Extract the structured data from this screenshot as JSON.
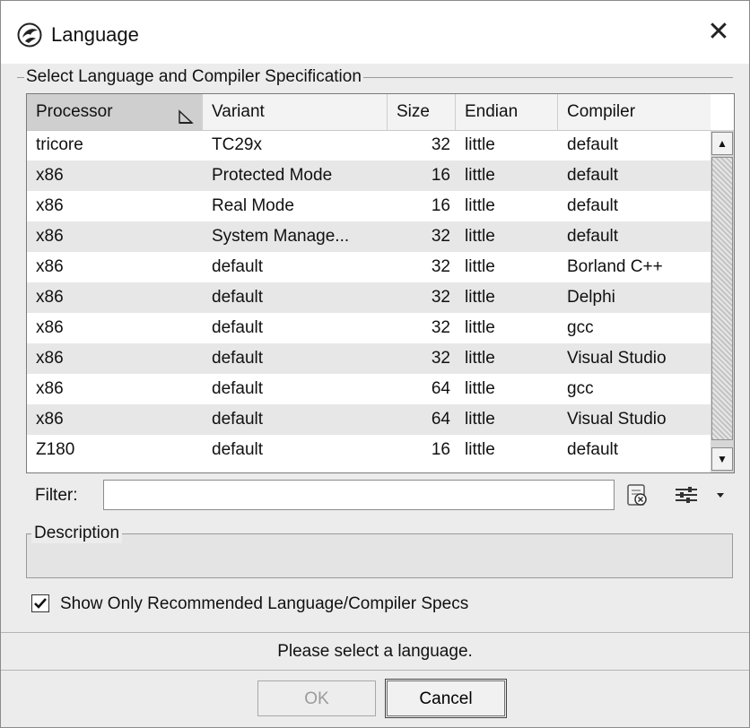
{
  "window": {
    "title": "Language",
    "close_glyph": "✕"
  },
  "table_group": {
    "legend": "Select Language and Compiler Specification",
    "columns": [
      "Processor",
      "Variant",
      "Size",
      "Endian",
      "Compiler"
    ],
    "sorted_column": "Processor",
    "rows": [
      [
        "tricore",
        "TC29x",
        "32",
        "little",
        "default"
      ],
      [
        "x86",
        "Protected Mode",
        "16",
        "little",
        "default"
      ],
      [
        "x86",
        "Real Mode",
        "16",
        "little",
        "default"
      ],
      [
        "x86",
        "System Manage...",
        "32",
        "little",
        "default"
      ],
      [
        "x86",
        "default",
        "32",
        "little",
        "Borland C++"
      ],
      [
        "x86",
        "default",
        "32",
        "little",
        "Delphi"
      ],
      [
        "x86",
        "default",
        "32",
        "little",
        "gcc"
      ],
      [
        "x86",
        "default",
        "32",
        "little",
        "Visual Studio"
      ],
      [
        "x86",
        "default",
        "64",
        "little",
        "gcc"
      ],
      [
        "x86",
        "default",
        "64",
        "little",
        "Visual Studio"
      ],
      [
        "Z180",
        "default",
        "16",
        "little",
        "default"
      ]
    ]
  },
  "filter": {
    "label": "Filter:",
    "value": "",
    "placeholder": ""
  },
  "icons": {
    "app": "ghidra-dragon-icon",
    "clear_filter": "clear-filter-icon",
    "filter_options": "filter-options-icon",
    "sort": "sort-ascending-icon"
  },
  "description": {
    "label": "Description",
    "text": ""
  },
  "recommended": {
    "label": "Show Only Recommended Language/Compiler Specs",
    "checked": true
  },
  "status": "Please select a language.",
  "buttons": {
    "ok": "OK",
    "cancel": "Cancel"
  }
}
